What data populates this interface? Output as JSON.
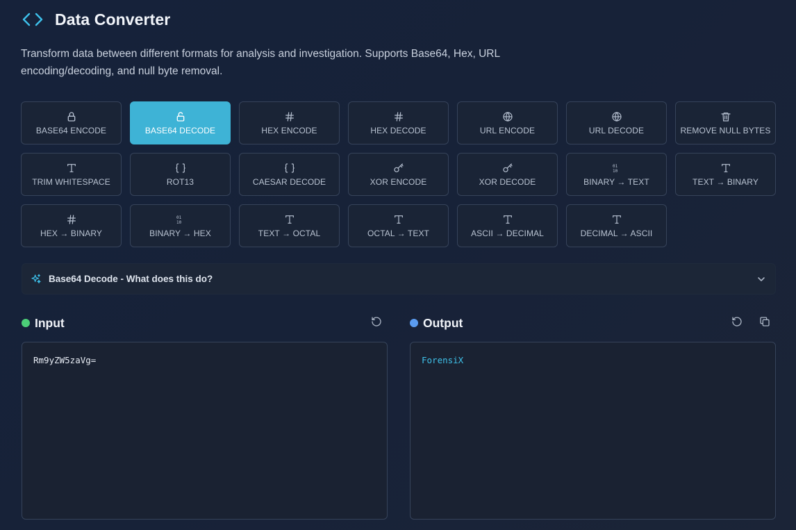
{
  "header": {
    "title": "Data Converter",
    "icon": "code-brackets-icon",
    "accent": "#3eb3d6"
  },
  "description": "Transform data between different formats for analysis and investigation. Supports Base64, Hex, URL encoding/decoding, and null byte removal.",
  "tools": [
    {
      "label": "BASE64 ENCODE",
      "icon": "lock-icon",
      "active": false
    },
    {
      "label": "BASE64 DECODE",
      "icon": "unlock-icon",
      "active": true
    },
    {
      "label": "HEX ENCODE",
      "icon": "hash-icon",
      "active": false
    },
    {
      "label": "HEX DECODE",
      "icon": "hash-icon",
      "active": false
    },
    {
      "label": "URL ENCODE",
      "icon": "globe-icon",
      "active": false
    },
    {
      "label": "URL DECODE",
      "icon": "globe-icon",
      "active": false
    },
    {
      "label": "REMOVE NULL BYTES",
      "icon": "trash-icon",
      "active": false
    },
    {
      "label": "TRIM WHITESPACE",
      "icon": "type-icon",
      "active": false
    },
    {
      "label": "ROT13",
      "icon": "braces-icon",
      "active": false
    },
    {
      "label": "CAESAR DECODE",
      "icon": "braces-icon",
      "active": false
    },
    {
      "label": "XOR ENCODE",
      "icon": "key-icon",
      "active": false
    },
    {
      "label": "XOR DECODE",
      "icon": "key-icon",
      "active": false
    },
    {
      "label": "BINARY → TEXT",
      "icon": "binary-icon",
      "active": false
    },
    {
      "label": "TEXT → BINARY",
      "icon": "type-icon",
      "active": false
    },
    {
      "label": "HEX → BINARY",
      "icon": "hash-icon",
      "active": false
    },
    {
      "label": "BINARY → HEX",
      "icon": "binary-icon",
      "active": false
    },
    {
      "label": "TEXT → OCTAL",
      "icon": "type-icon",
      "active": false
    },
    {
      "label": "OCTAL → TEXT",
      "icon": "type-icon",
      "active": false
    },
    {
      "label": "ASCII → DECIMAL",
      "icon": "type-icon",
      "active": false
    },
    {
      "label": "DECIMAL → ASCII",
      "icon": "type-icon",
      "active": false
    }
  ],
  "help": {
    "label": "Base64 Decode - What does this do?",
    "icon": "sparkles-icon",
    "expanded": false
  },
  "input": {
    "title": "Input",
    "value": "Rm9yZW5zaVg=",
    "dot_color": "#4ccf78"
  },
  "output": {
    "title": "Output",
    "value": "ForensiX",
    "dot_color": "#5b9cf0"
  }
}
